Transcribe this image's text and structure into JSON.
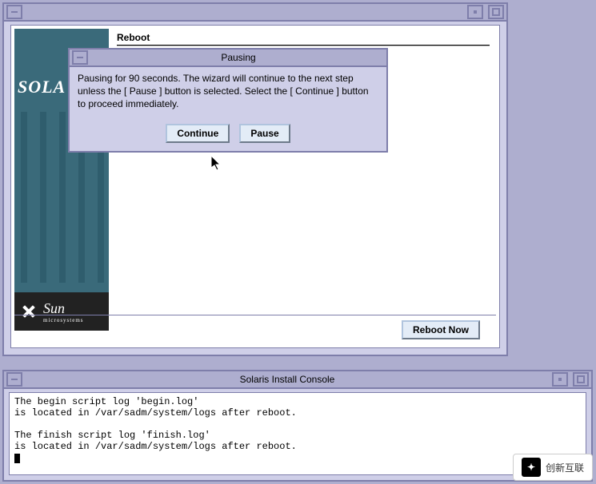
{
  "installer": {
    "sidebar": {
      "brand_text": "SOLA",
      "logo_main": "Sun",
      "logo_sub": "microsystems"
    },
    "page_title": "Reboot",
    "reboot_button": "Reboot Now"
  },
  "pausing_dialog": {
    "title": "Pausing",
    "message": "Pausing for 90 seconds. The wizard will continue to the next step unless the [ Pause ] button is selected. Select the [ Continue ] button to proceed immediately.",
    "continue_label": "Continue",
    "pause_label": "Pause"
  },
  "console": {
    "title": "Solaris Install Console",
    "lines": [
      "The begin script log 'begin.log'",
      "is located in /var/sadm/system/logs after reboot.",
      "",
      "The finish script log 'finish.log'",
      "is located in /var/sadm/system/logs after reboot.",
      ""
    ]
  },
  "watermark": {
    "text": "创新互联"
  },
  "colors": {
    "desktop_bg": "#aeaecf",
    "window_border": "#7e7eaa",
    "window_bg": "#cfcfe8",
    "button_bg": "#e3ecf7"
  }
}
